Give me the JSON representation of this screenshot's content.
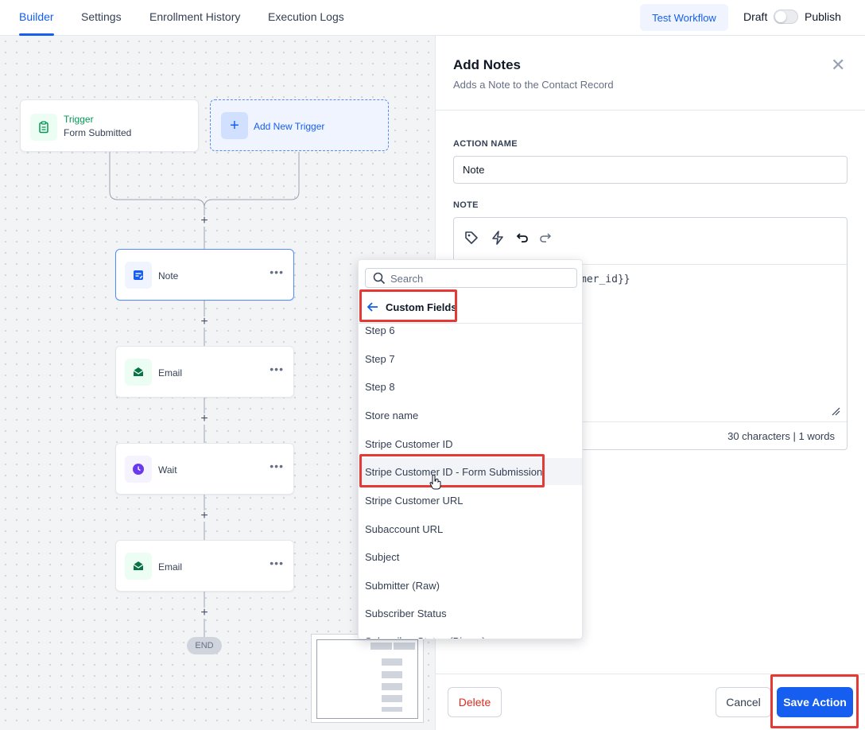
{
  "tabs": [
    {
      "label": "Builder",
      "active": true
    },
    {
      "label": "Settings",
      "active": false
    },
    {
      "label": "Enrollment History",
      "active": false
    },
    {
      "label": "Execution Logs",
      "active": false
    }
  ],
  "header": {
    "test_workflow": "Test Workflow",
    "draft": "Draft",
    "publish": "Publish",
    "published": false
  },
  "canvas": {
    "trigger": {
      "title": "Trigger",
      "subtitle": "Form Submitted",
      "icon": "clipboard-icon"
    },
    "add_trigger": "Add New Trigger",
    "nodes": [
      {
        "label": "Note",
        "icon": "note-icon",
        "selected": true
      },
      {
        "label": "Email",
        "icon": "email-icon",
        "selected": false
      },
      {
        "label": "Wait",
        "icon": "clock-icon",
        "selected": false
      },
      {
        "label": "Email",
        "icon": "email-icon",
        "selected": false
      }
    ],
    "end": "END"
  },
  "panel": {
    "title": "Add Notes",
    "subtitle": "Adds a Note to the Contact Record",
    "action_name_label": "ACTION NAME",
    "action_name_value": "Note",
    "note_label": "NOTE",
    "note_content_visible": "mer_id}}",
    "counter": "30 characters | 1 words",
    "delete": "Delete",
    "cancel": "Cancel",
    "save": "Save Action"
  },
  "dropdown": {
    "search_placeholder": "Search",
    "back_label": "Custom Fields",
    "items": [
      "Step 6",
      "Step 7",
      "Step 8",
      "Store name",
      "Stripe Customer ID",
      "Stripe Customer ID - Form Submission",
      "Stripe Customer URL",
      "Subaccount URL",
      "Subject",
      "Submitter (Raw)",
      "Subscriber Status",
      "Subscriber Status (Binary)"
    ],
    "hovered_index": 5
  },
  "colors": {
    "accent": "#155eef",
    "highlight": "#e53935",
    "delete": "#d92d20",
    "trigger_green": "#039855",
    "wait_purple": "#6938ef"
  }
}
